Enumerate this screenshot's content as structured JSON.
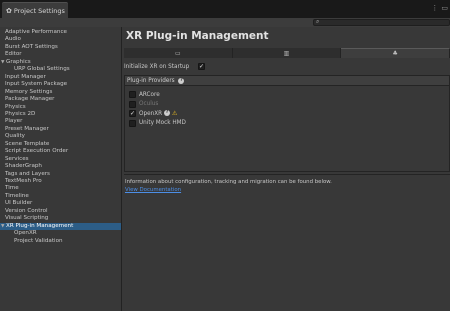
{
  "window": {
    "tab_title": "Project Settings",
    "tab_icon": "gear-icon",
    "menu_icon": "kebab-menu-icon",
    "maximize_icon": "maximize-icon"
  },
  "search": {
    "placeholder": "",
    "icon": "search-icon"
  },
  "sidebar": {
    "items": [
      {
        "label": "Adaptive Performance",
        "indent": 0
      },
      {
        "label": "Audio",
        "indent": 0
      },
      {
        "label": "Burst AOT Settings",
        "indent": 0
      },
      {
        "label": "Editor",
        "indent": 0
      },
      {
        "label": "Graphics",
        "indent": 0,
        "expanded": true
      },
      {
        "label": "URP Global Settings",
        "indent": 1
      },
      {
        "label": "Input Manager",
        "indent": 0
      },
      {
        "label": "Input System Package",
        "indent": 0
      },
      {
        "label": "Memory Settings",
        "indent": 0
      },
      {
        "label": "Package Manager",
        "indent": 0
      },
      {
        "label": "Physics",
        "indent": 0
      },
      {
        "label": "Physics 2D",
        "indent": 0
      },
      {
        "label": "Player",
        "indent": 0
      },
      {
        "label": "Preset Manager",
        "indent": 0
      },
      {
        "label": "Quality",
        "indent": 0
      },
      {
        "label": "Scene Template",
        "indent": 0
      },
      {
        "label": "Script Execution Order",
        "indent": 0
      },
      {
        "label": "Services",
        "indent": 0
      },
      {
        "label": "ShaderGraph",
        "indent": 0
      },
      {
        "label": "Tags and Layers",
        "indent": 0
      },
      {
        "label": "TextMesh Pro",
        "indent": 0
      },
      {
        "label": "Time",
        "indent": 0
      },
      {
        "label": "Timeline",
        "indent": 0
      },
      {
        "label": "UI Builder",
        "indent": 0
      },
      {
        "label": "Version Control",
        "indent": 0
      },
      {
        "label": "Visual Scripting",
        "indent": 0
      },
      {
        "label": "XR Plug-in Management",
        "indent": 0,
        "expanded": true,
        "selected": true
      },
      {
        "label": "OpenXR",
        "indent": 1
      },
      {
        "label": "Project Validation",
        "indent": 1
      }
    ]
  },
  "main": {
    "title": "XR Plug-in Management",
    "platform_tabs": [
      {
        "icon": "desktop-monitor-icon",
        "glyph": "▭",
        "active": false
      },
      {
        "icon": "server-icon",
        "glyph": "▥",
        "active": false
      },
      {
        "icon": "android-icon",
        "glyph": "♣",
        "active": true
      }
    ],
    "init_label": "Initialize XR on Startup",
    "init_checked": true,
    "providers_header": "Plug-in Providers",
    "providers": [
      {
        "label": "ARCore",
        "checked": false,
        "disabled": false,
        "warning": false,
        "help": false
      },
      {
        "label": "Oculus",
        "checked": false,
        "disabled": true,
        "warning": false,
        "help": false
      },
      {
        "label": "OpenXR",
        "checked": true,
        "disabled": false,
        "warning": true,
        "help": true
      },
      {
        "label": "Unity Mock HMD",
        "checked": false,
        "disabled": false,
        "warning": false,
        "help": false
      }
    ],
    "info_text": "Information about configuration, tracking and migration can be found below.",
    "link_text": "View Documentation"
  },
  "colors": {
    "selection": "#2c5d87",
    "link": "#4c8ee6",
    "warning": "#f0c020",
    "panel": "#383838"
  }
}
